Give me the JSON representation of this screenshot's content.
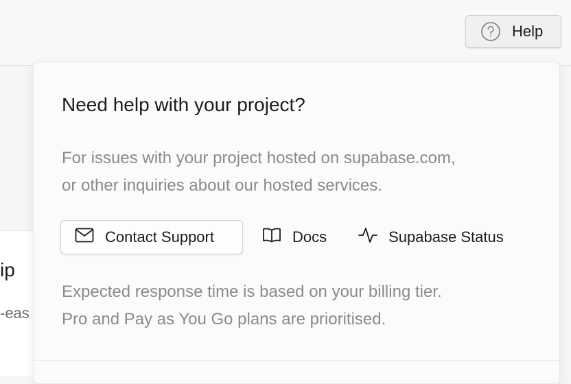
{
  "help_button": {
    "label": "Help",
    "icon": "question-circle-icon"
  },
  "background": {
    "heading_fragment": "ip",
    "subtext_fragment": "-eas"
  },
  "popover": {
    "title": "Need help with your project?",
    "description_line1": "For issues with your project hosted on supabase.com,",
    "description_line2": "or other inquiries about our hosted services.",
    "actions": {
      "contact_support": {
        "label": "Contact Support",
        "icon": "mail-icon"
      },
      "docs": {
        "label": "Docs",
        "icon": "book-icon"
      },
      "status": {
        "label": "Supabase Status",
        "icon": "activity-icon"
      }
    },
    "note_line1": "Expected response time is based on your billing tier.",
    "note_line2": "Pro and Pay as You Go plans are prioritised."
  },
  "colors": {
    "text_primary": "#1c1c1c",
    "text_muted": "#8a8a8a",
    "border": "#d2d2d2"
  }
}
